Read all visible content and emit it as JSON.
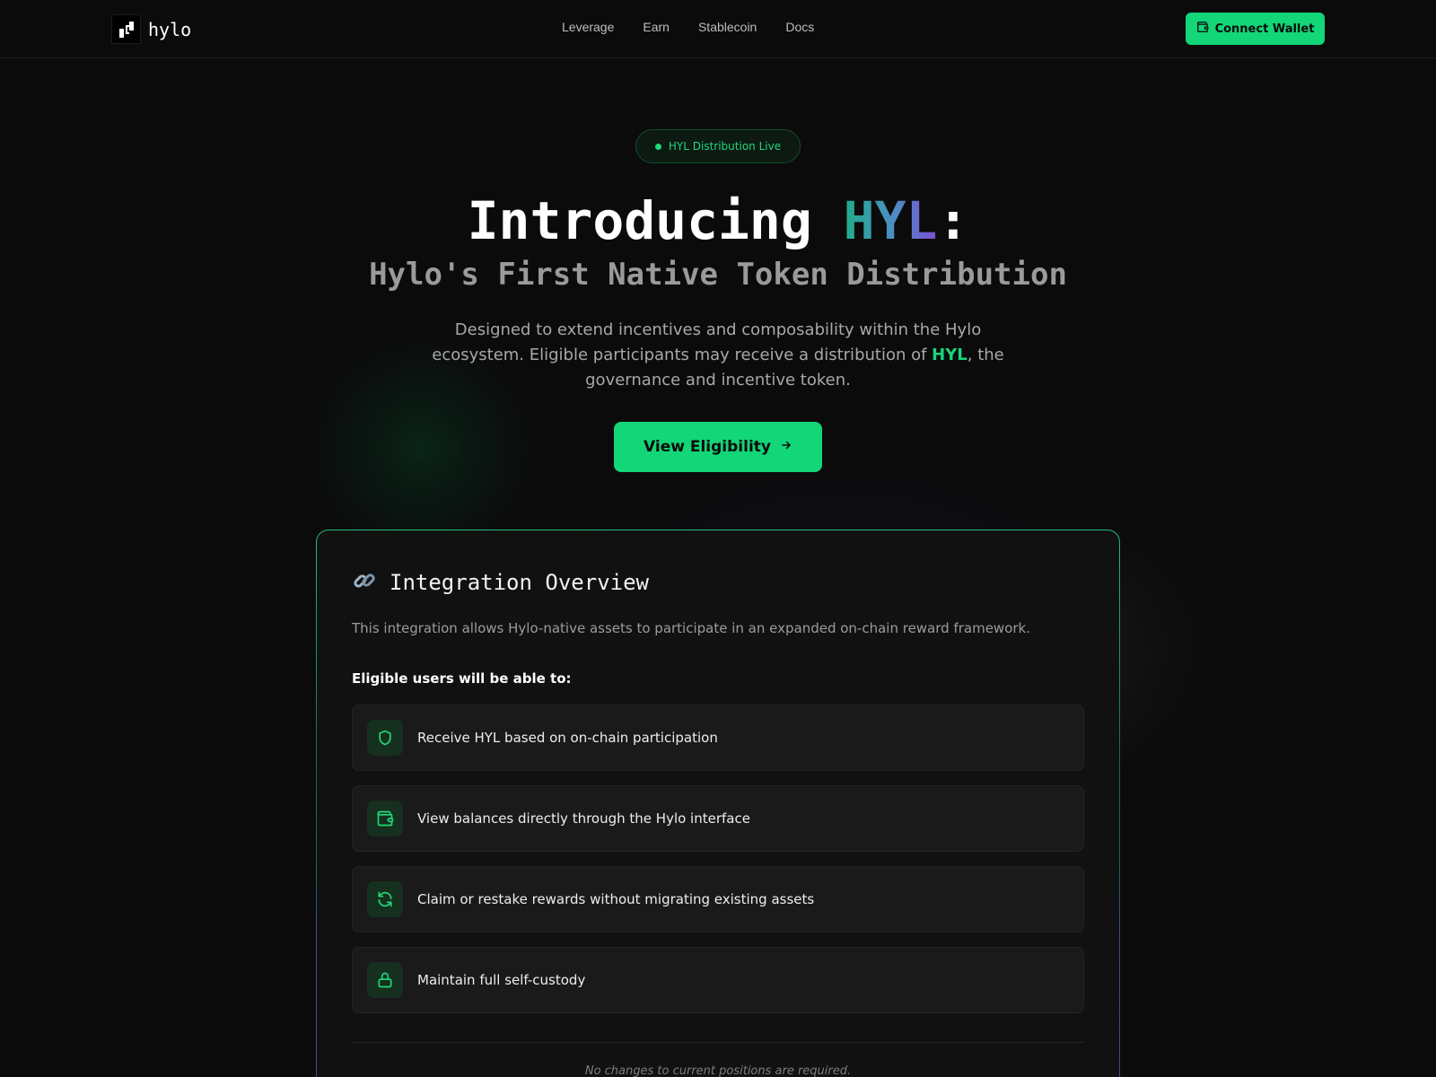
{
  "header": {
    "logo_text": "hylo",
    "nav": [
      "Leverage",
      "Earn",
      "Stablecoin",
      "Docs"
    ],
    "connect_label": "Connect Wallet"
  },
  "hero": {
    "badge": "HYL Distribution Live",
    "title_prefix": "Introducing ",
    "title_highlight": "HYL",
    "title_suffix": ":",
    "subtitle": "Hylo's First Native Token Distribution",
    "desc_part1": "Designed to extend incentives and composability within the Hylo ecosystem. Eligible participants may receive a distribution of ",
    "desc_highlight": "HYL",
    "desc_part2": ", the governance and incentive token.",
    "cta_label": "View Eligibility"
  },
  "card": {
    "title": "Integration Overview",
    "description": "This integration allows Hylo-native assets to participate in an expanded on-chain reward framework.",
    "label": "Eligible users will be able to:",
    "features": [
      {
        "icon": "shield-icon",
        "text": "Receive HYL based on on-chain participation"
      },
      {
        "icon": "wallet-icon",
        "text": "View balances directly through the Hylo interface"
      },
      {
        "icon": "refresh-icon",
        "text": "Claim or restake rewards without migrating existing assets"
      },
      {
        "icon": "lock-icon",
        "text": "Maintain full self-custody"
      }
    ],
    "footer": "No changes to current positions are required."
  },
  "colors": {
    "accent": "#12d677",
    "background": "#0b0b0b",
    "card_bg": "#111111"
  }
}
